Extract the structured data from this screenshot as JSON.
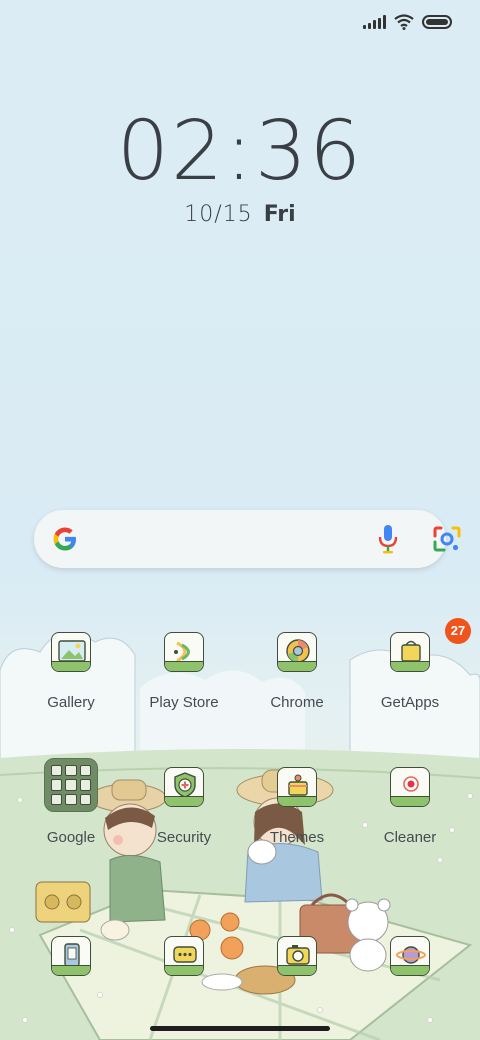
{
  "status_bar": {
    "icons": [
      "signal-icon",
      "wifi-icon",
      "battery-icon"
    ]
  },
  "lockclock": {
    "time": "02:36",
    "date_num": "10/15",
    "date_day": "Fri"
  },
  "search": {
    "icons": [
      "google-logo-icon",
      "microphone-icon",
      "lens-camera-icon"
    ]
  },
  "apps": {
    "row1": [
      {
        "label": "Gallery",
        "icon": "gallery-icon"
      },
      {
        "label": "Play Store",
        "icon": "play-store-icon"
      },
      {
        "label": "Chrome",
        "icon": "chrome-icon"
      },
      {
        "label": "GetApps",
        "icon": "getapps-icon",
        "badge": "27"
      }
    ],
    "row2": [
      {
        "label": "Google",
        "icon": "google-folder-icon"
      },
      {
        "label": "Security",
        "icon": "security-icon"
      },
      {
        "label": "Themes",
        "icon": "themes-icon"
      },
      {
        "label": "Cleaner",
        "icon": "cleaner-icon"
      }
    ],
    "dock": [
      {
        "icon": "phone-icon"
      },
      {
        "icon": "messaging-icon"
      },
      {
        "icon": "camera-icon"
      },
      {
        "icon": "browser-icon"
      }
    ]
  },
  "colors": {
    "badge": "#f0531b",
    "text": "#444c52",
    "clock": "#3a3f46",
    "grass": "#8fc36b"
  }
}
